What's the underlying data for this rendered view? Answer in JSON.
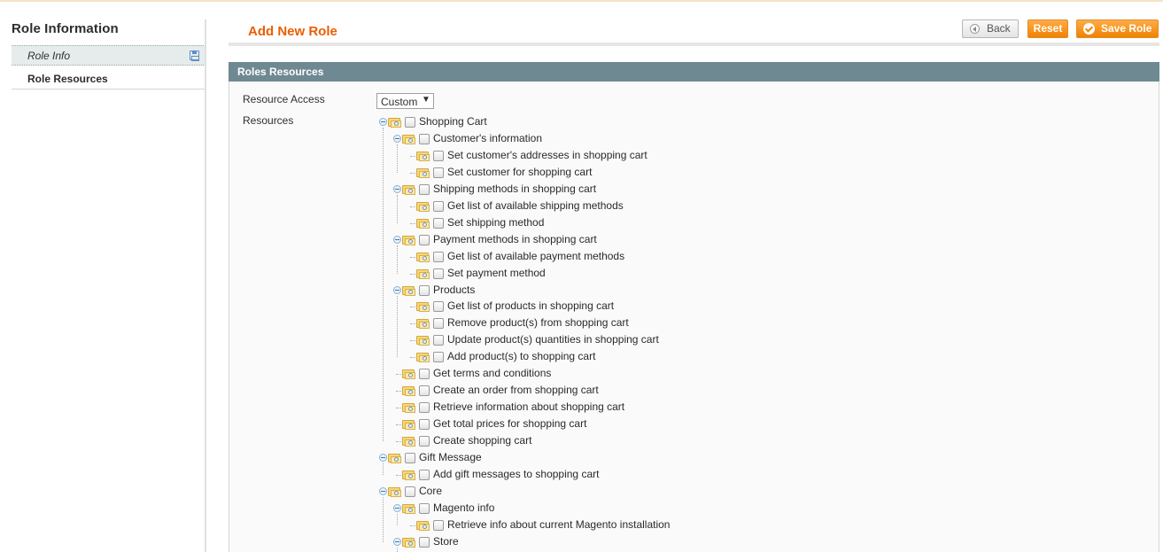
{
  "sidebar": {
    "title": "Role Information",
    "tabs": [
      {
        "label": "Role Info"
      },
      {
        "label": "Role Resources"
      }
    ]
  },
  "header": {
    "title": "Add New Role",
    "buttons": {
      "back": "Back",
      "reset": "Reset",
      "save": "Save Role"
    }
  },
  "section": {
    "title": "Roles Resources",
    "resource_access_label": "Resource Access",
    "resource_access_value": "Custom",
    "resources_label": "Resources"
  },
  "colors": {
    "accent": "#eb5e00",
    "section_header": "#6f8992",
    "button": "#f18200"
  },
  "tree": [
    {
      "label": "Shopping Cart",
      "level": 0,
      "expanded": true
    },
    {
      "label": "Customer's information",
      "level": 1,
      "expanded": true
    },
    {
      "label": "Set customer's addresses in shopping cart",
      "level": 2
    },
    {
      "label": "Set customer for shopping cart",
      "level": 2
    },
    {
      "label": "Shipping methods in shopping cart",
      "level": 1,
      "expanded": true
    },
    {
      "label": "Get list of available shipping methods",
      "level": 2
    },
    {
      "label": "Set shipping method",
      "level": 2
    },
    {
      "label": "Payment methods in shopping cart",
      "level": 1,
      "expanded": true
    },
    {
      "label": "Get list of available payment methods",
      "level": 2
    },
    {
      "label": "Set payment method",
      "level": 2
    },
    {
      "label": "Products",
      "level": 1,
      "expanded": true
    },
    {
      "label": "Get list of products in shopping cart",
      "level": 2
    },
    {
      "label": "Remove product(s) from shopping cart",
      "level": 2
    },
    {
      "label": "Update product(s) quantities in shopping cart",
      "level": 2
    },
    {
      "label": "Add product(s) to shopping cart",
      "level": 2
    },
    {
      "label": "Get terms and conditions",
      "level": 1
    },
    {
      "label": "Create an order from shopping cart",
      "level": 1
    },
    {
      "label": "Retrieve information about shopping cart",
      "level": 1
    },
    {
      "label": "Get total prices for shopping cart",
      "level": 1
    },
    {
      "label": "Create shopping cart",
      "level": 1
    },
    {
      "label": "Gift Message",
      "level": 0,
      "expanded": true
    },
    {
      "label": "Add gift messages to shopping cart",
      "level": 1
    },
    {
      "label": "Core",
      "level": 0,
      "expanded": true
    },
    {
      "label": "Magento info",
      "level": 1,
      "expanded": true
    },
    {
      "label": "Retrieve info about current Magento installation",
      "level": 2
    },
    {
      "label": "Store",
      "level": 1,
      "expanded": true
    },
    {
      "label": "",
      "level": 2
    }
  ]
}
